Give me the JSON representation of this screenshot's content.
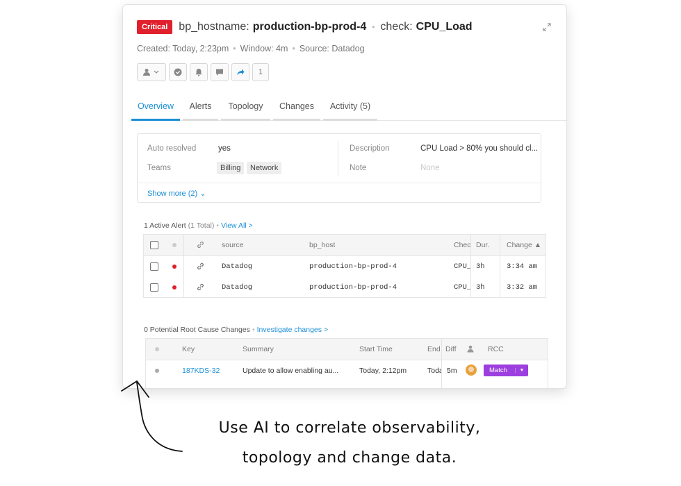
{
  "header": {
    "severity": "Critical",
    "field1_key": "bp_hostname:",
    "field1_value": "production-bp-prod-4",
    "field2_key": "check:",
    "field2_value": "CPU_Load",
    "expand_icon": "expand-icon"
  },
  "meta": {
    "created": "Created: Today, 2:23pm",
    "window": "Window: 4m",
    "source": "Source: Datadog"
  },
  "toolbar": {
    "buttons": [
      "assign-user-icon",
      "check-icon",
      "bell-icon",
      "comment-icon",
      "share-icon"
    ],
    "count": "1"
  },
  "tabs": [
    {
      "label": "Overview",
      "active": true
    },
    {
      "label": "Alerts"
    },
    {
      "label": "Topology"
    },
    {
      "label": "Changes"
    },
    {
      "label": "Activity (5)"
    }
  ],
  "properties": {
    "auto_resolved_label": "Auto resolved",
    "auto_resolved_value": "yes",
    "teams_label": "Teams",
    "teams": [
      "Billing",
      "Network"
    ],
    "description_label": "Description",
    "description_value": "CPU Load > 80% you should cl...",
    "note_label": "Note",
    "note_value": "None",
    "show_more": "Show more (2) ⌄"
  },
  "alerts_section": {
    "title": "1 Active Alert",
    "total": "(1 Total)",
    "link": "View All >",
    "columns": [
      "source",
      "bp_host",
      "Chec",
      "Dur.",
      "Change ▲"
    ],
    "rows": [
      {
        "source": "Datadog",
        "bp_host": "production-bp-prod-4",
        "check": "CPU_",
        "dur": "3h",
        "change": "3:34 am"
      },
      {
        "source": "Datadog",
        "bp_host": "production-bp-prod-4",
        "check": "CPU_",
        "dur": "3h",
        "change": "3:32 am"
      }
    ]
  },
  "changes_section": {
    "title": "0 Potential Root Cause Changes",
    "link": "Investigate changes >",
    "columns": [
      "Key",
      "Summary",
      "Start Time",
      "End",
      "Diff",
      "RCC"
    ],
    "rows": [
      {
        "key": "187KDS-32",
        "summary": "Update to allow enabling au...",
        "start": "Today, 2:12pm",
        "end": "Toda",
        "diff": "5m",
        "rcc": "Match"
      }
    ]
  },
  "caption": {
    "line1": "Use AI to correlate observability,",
    "line2": "topology and change data."
  }
}
